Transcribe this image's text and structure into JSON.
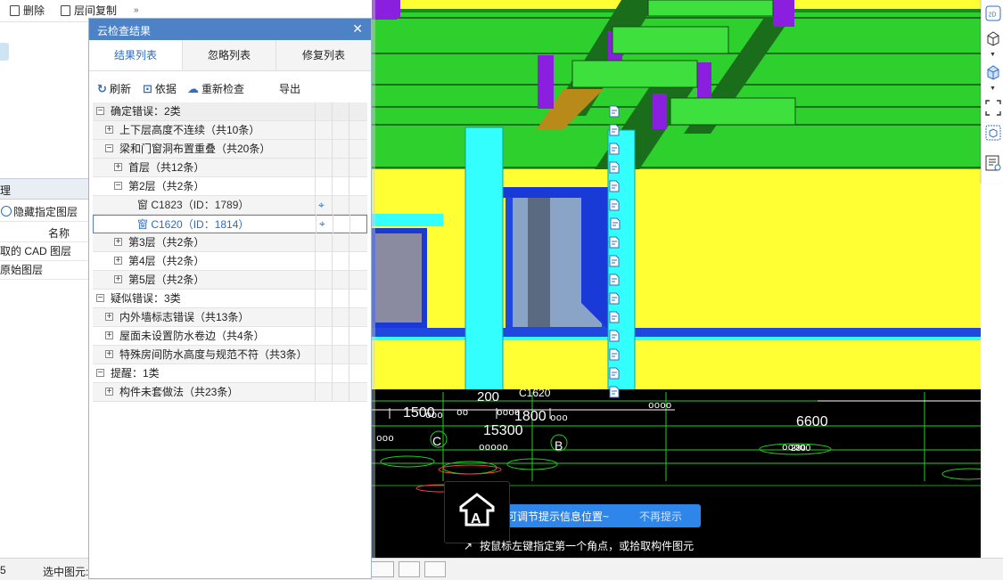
{
  "bg_toolbar": {
    "delete_label": "删除",
    "copy_label": "层间复制",
    "more": "»"
  },
  "bg_left": {
    "tab_label": "理",
    "hide_layer_label": "隐藏指定图层",
    "name_header": "名称",
    "rows": [
      "取的 CAD 图层",
      "原始图层"
    ]
  },
  "dialog": {
    "title": "云检查结果",
    "close": "✕",
    "tabs": [
      "结果列表",
      "忽略列表",
      "修复列表"
    ],
    "actions": {
      "refresh": "刷新",
      "basis": "依据",
      "recheck": "重新检查",
      "export": "导出"
    },
    "rows": [
      {
        "label": "确定错误：2类",
        "sign": "−"
      },
      {
        "label": "上下层高度不连续（共10条）",
        "sign": "+"
      },
      {
        "label": "梁和门窗洞布置重叠（共20条）",
        "sign": "−"
      },
      {
        "label": "首层（共12条）",
        "sign": "+"
      },
      {
        "label": "第2层（共2条）",
        "sign": "−"
      },
      {
        "label": "窗 C1823（ID：1789）",
        "sign": ""
      },
      {
        "label": "窗 C1620（ID：1814）",
        "sign": ""
      },
      {
        "label": "第3层（共2条）",
        "sign": "+"
      },
      {
        "label": "第4层（共2条）",
        "sign": "+"
      },
      {
        "label": "第5层（共2条）",
        "sign": "+"
      },
      {
        "label": "疑似错误：3类",
        "sign": "−"
      },
      {
        "label": "内外墙标志错误（共13条）",
        "sign": "+"
      },
      {
        "label": "屋面未设置防水卷边（共4条）",
        "sign": "+"
      },
      {
        "label": "特殊房间防水高度与规范不符（共3条）",
        "sign": "+"
      },
      {
        "label": "提醒：1类",
        "sign": "−"
      },
      {
        "label": "构件未套做法（共23条）",
        "sign": "+"
      }
    ]
  },
  "viewport": {
    "dims": [
      "200",
      "1500",
      "1800",
      "15300",
      "6600"
    ],
    "axis_labels": [
      "C",
      "B"
    ],
    "overlay": [
      "C1620",
      "2800"
    ]
  },
  "right_tools": {
    "two_d": "2D"
  },
  "tooltip": {
    "message": "可调节提示信息位置~",
    "dismiss": "不再提示",
    "command": "按鼠标左键指定第一个角点，或拾取构件图元",
    "logo": "A"
  },
  "status": {
    "left_num": "5",
    "select_label": "选中图元:"
  },
  "colors": {
    "title_bar": "#4d82c6",
    "slab": "#2ed02e",
    "wall": "#ffff33",
    "column": "#33ffff",
    "beam": "#8a1fe0",
    "tip": "#2f86ea"
  }
}
